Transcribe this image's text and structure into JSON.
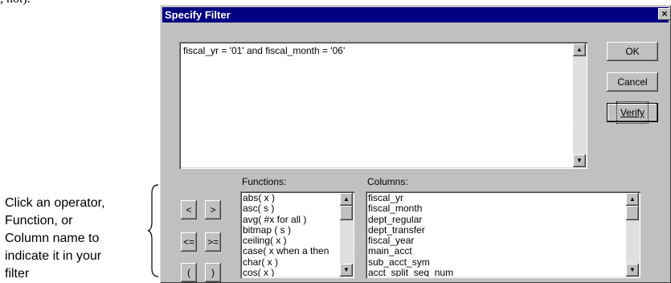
{
  "page_fragment": ", not).",
  "dialog": {
    "title": "Specify Filter",
    "close_label": "×",
    "filter_expression": "fiscal_yr = '01' and  fiscal_month = '06'",
    "buttons": {
      "ok": "OK",
      "cancel": "Cancel",
      "verify": "Verify"
    },
    "operators": [
      "<",
      ">",
      "<=",
      ">=",
      "(",
      ")"
    ],
    "functions_label": "Functions:",
    "columns_label": "Columns:",
    "functions": [
      "abs( x )",
      "asc( s )",
      "avg( #x for all )",
      "bitmap ( s )",
      "ceiling( x )",
      "case( x when a then",
      "char( x )",
      "cos( x )"
    ],
    "columns": [
      "fiscal_yr",
      "fiscal_month",
      "dept_regular",
      "dept_transfer",
      "fiscal_year",
      "main_acct",
      "sub_acct_sym",
      "acct_split_seq_num"
    ]
  },
  "callout": [
    "Click an operator,",
    "Function, or",
    "Column name to",
    "indicate it in your",
    "filter"
  ]
}
